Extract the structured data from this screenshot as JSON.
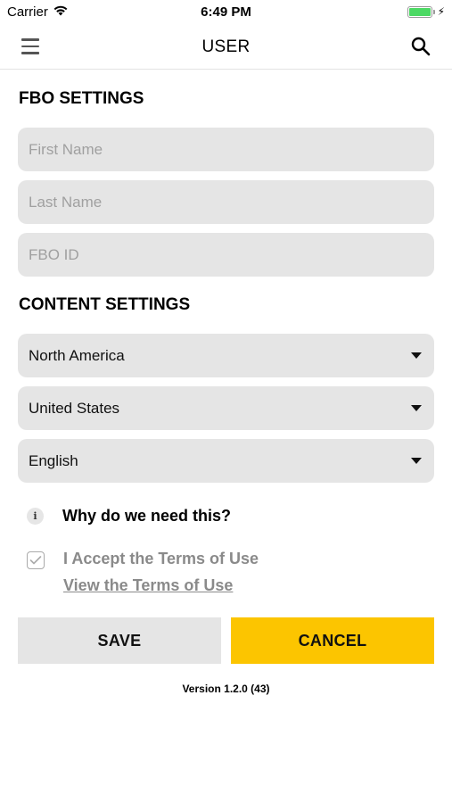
{
  "status_bar": {
    "carrier": "Carrier",
    "time": "6:49 PM",
    "battery_level": 1.0,
    "charging": true
  },
  "nav": {
    "title": "USER",
    "menu_icon": "hamburger-menu-icon",
    "search_icon": "search-icon"
  },
  "fbo_settings": {
    "heading": "FBO SETTINGS",
    "first_name": {
      "value": "",
      "placeholder": "First Name"
    },
    "last_name": {
      "value": "",
      "placeholder": "Last Name"
    },
    "fbo_id": {
      "value": "",
      "placeholder": "FBO ID"
    }
  },
  "content_settings": {
    "heading": "CONTENT SETTINGS",
    "region": "North America",
    "country": "United States",
    "language": "English"
  },
  "info": {
    "icon": "info-icon",
    "text": "Why do we need this?"
  },
  "terms": {
    "checked": true,
    "accept_text": "I Accept the Terms of Use",
    "link_text": "View the Terms of Use"
  },
  "actions": {
    "save_label": "SAVE",
    "cancel_label": "CANCEL"
  },
  "colors": {
    "accent": "#fcc500",
    "field_bg": "#e5e5e5",
    "muted_text": "#8a8a8a",
    "battery": "#4cd964"
  },
  "version": "Version 1.2.0 (43)"
}
